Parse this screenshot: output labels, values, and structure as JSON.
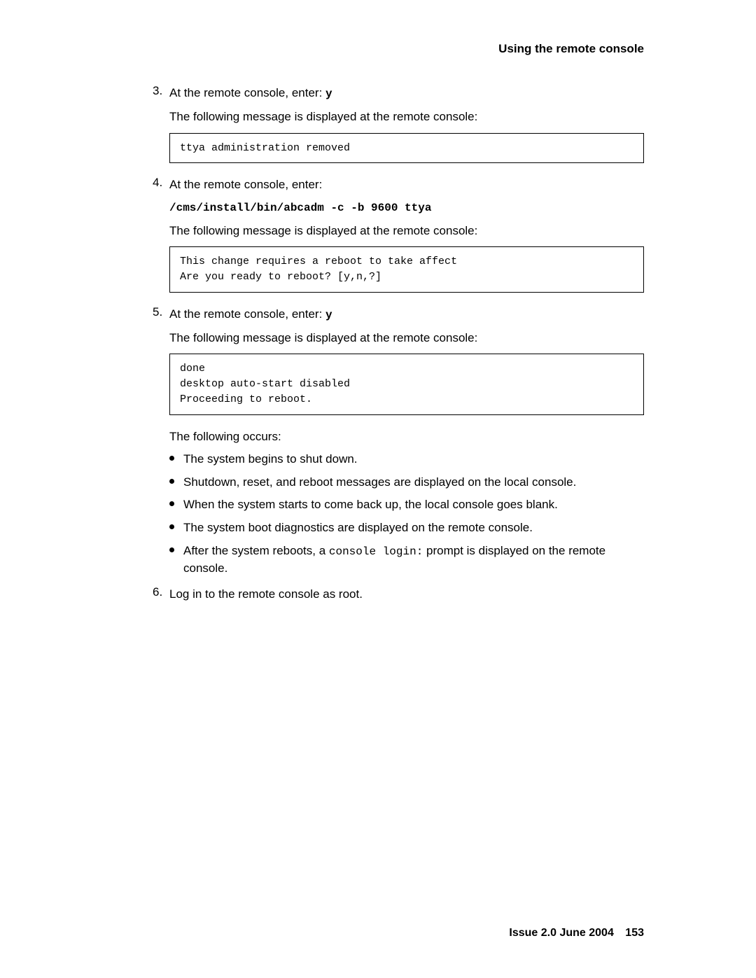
{
  "header": {
    "title": "Using the remote console"
  },
  "steps": {
    "s3": {
      "num": "3.",
      "intro_prefix": "At the remote console, enter: ",
      "intro_code": "y",
      "after": "The following message is displayed at the remote console:",
      "code": "ttya administration removed"
    },
    "s4": {
      "num": "4.",
      "intro": "At the remote console, enter:",
      "cmd": "/cms/install/bin/abcadm -c -b 9600 ttya",
      "after": "The following message is displayed at the remote console:",
      "code": "This change requires a reboot to take affect\nAre you ready to reboot? [y,n,?]"
    },
    "s5": {
      "num": "5.",
      "intro_prefix": "At the remote console, enter: ",
      "intro_code": "y",
      "after": "The following message is displayed at the remote console:",
      "code": "done\ndesktop auto-start disabled\nProceeding to reboot.",
      "occurs": "The following occurs:",
      "bullets": [
        "The system begins to shut down.",
        "Shutdown, reset, and reboot messages are displayed on the local console.",
        "When the system starts to come back up, the local console goes blank.",
        "The system boot diagnostics are displayed on the remote console."
      ],
      "bullet5_pre": "After the system reboots, a ",
      "bullet5_code": "console login:",
      "bullet5_post": " prompt is displayed on the remote console."
    },
    "s6": {
      "num": "6.",
      "text": "Log in to the remote console as root."
    }
  },
  "footer": {
    "issue": "Issue 2.0   June 2004",
    "page": "153"
  }
}
